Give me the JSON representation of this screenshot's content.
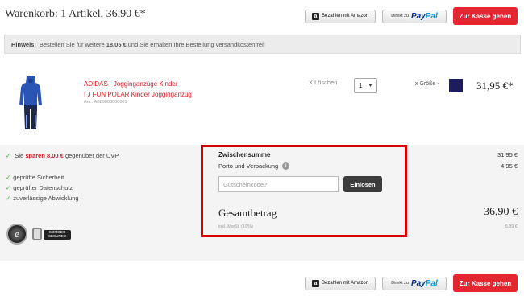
{
  "header": {
    "title": "Warenkorb: 1 Artikel, 36,90 €*"
  },
  "payment": {
    "amazon_label": "Bezahlen mit Amazon",
    "paypal_prefix": "Direkt zu",
    "paypal_logo_a": "Pay",
    "paypal_logo_b": "Pal",
    "checkout_label": "Zur Kasse gehen"
  },
  "hint": {
    "label": "Hinweis!",
    "text_before": "Bestellen Sie für weitere",
    "amount": "18,05 €",
    "text_after": "und Sie erhalten Ihre Bestellung versandkostenfrei!"
  },
  "item": {
    "title_line1": "ADIDAS - Jogginganzüge Kinder",
    "title_line2": "I J FUN POLAR Kinder Jogginganzug",
    "article_no": "Anr.: AB89803000001",
    "remove_label": "X Löschen",
    "quantity": "1",
    "size_label": "x Größe -",
    "swatch_color": "#1c1c5e",
    "price": "31,95 €*"
  },
  "benefits": {
    "save_prefix": "Sie",
    "save_amount": "sparen 8,00 €",
    "save_suffix": "gegenüber der UVP.",
    "items": [
      "geprüfte Sicherheit",
      "geprüfter Datenschutz",
      "zuverlässige Abwicklung"
    ],
    "comodo_label": "COMODO SECURED"
  },
  "summary": {
    "subtotal_label": "Zwischensumme",
    "shipping_label": "Porto und Verpackung",
    "coupon_placeholder": "Gutscheincode?",
    "redeem_label": "Einlösen",
    "total_label": "Gesamtbetrag",
    "tax_label": "inkl. MwSt. (19%)",
    "subtotal_value": "31,95 €",
    "shipping_value": "4,95 €",
    "total_value": "36,90 €",
    "tax_value": "5,89 €"
  },
  "colors": {
    "accent": "#e3262f",
    "highlight_box": "#d40000"
  }
}
